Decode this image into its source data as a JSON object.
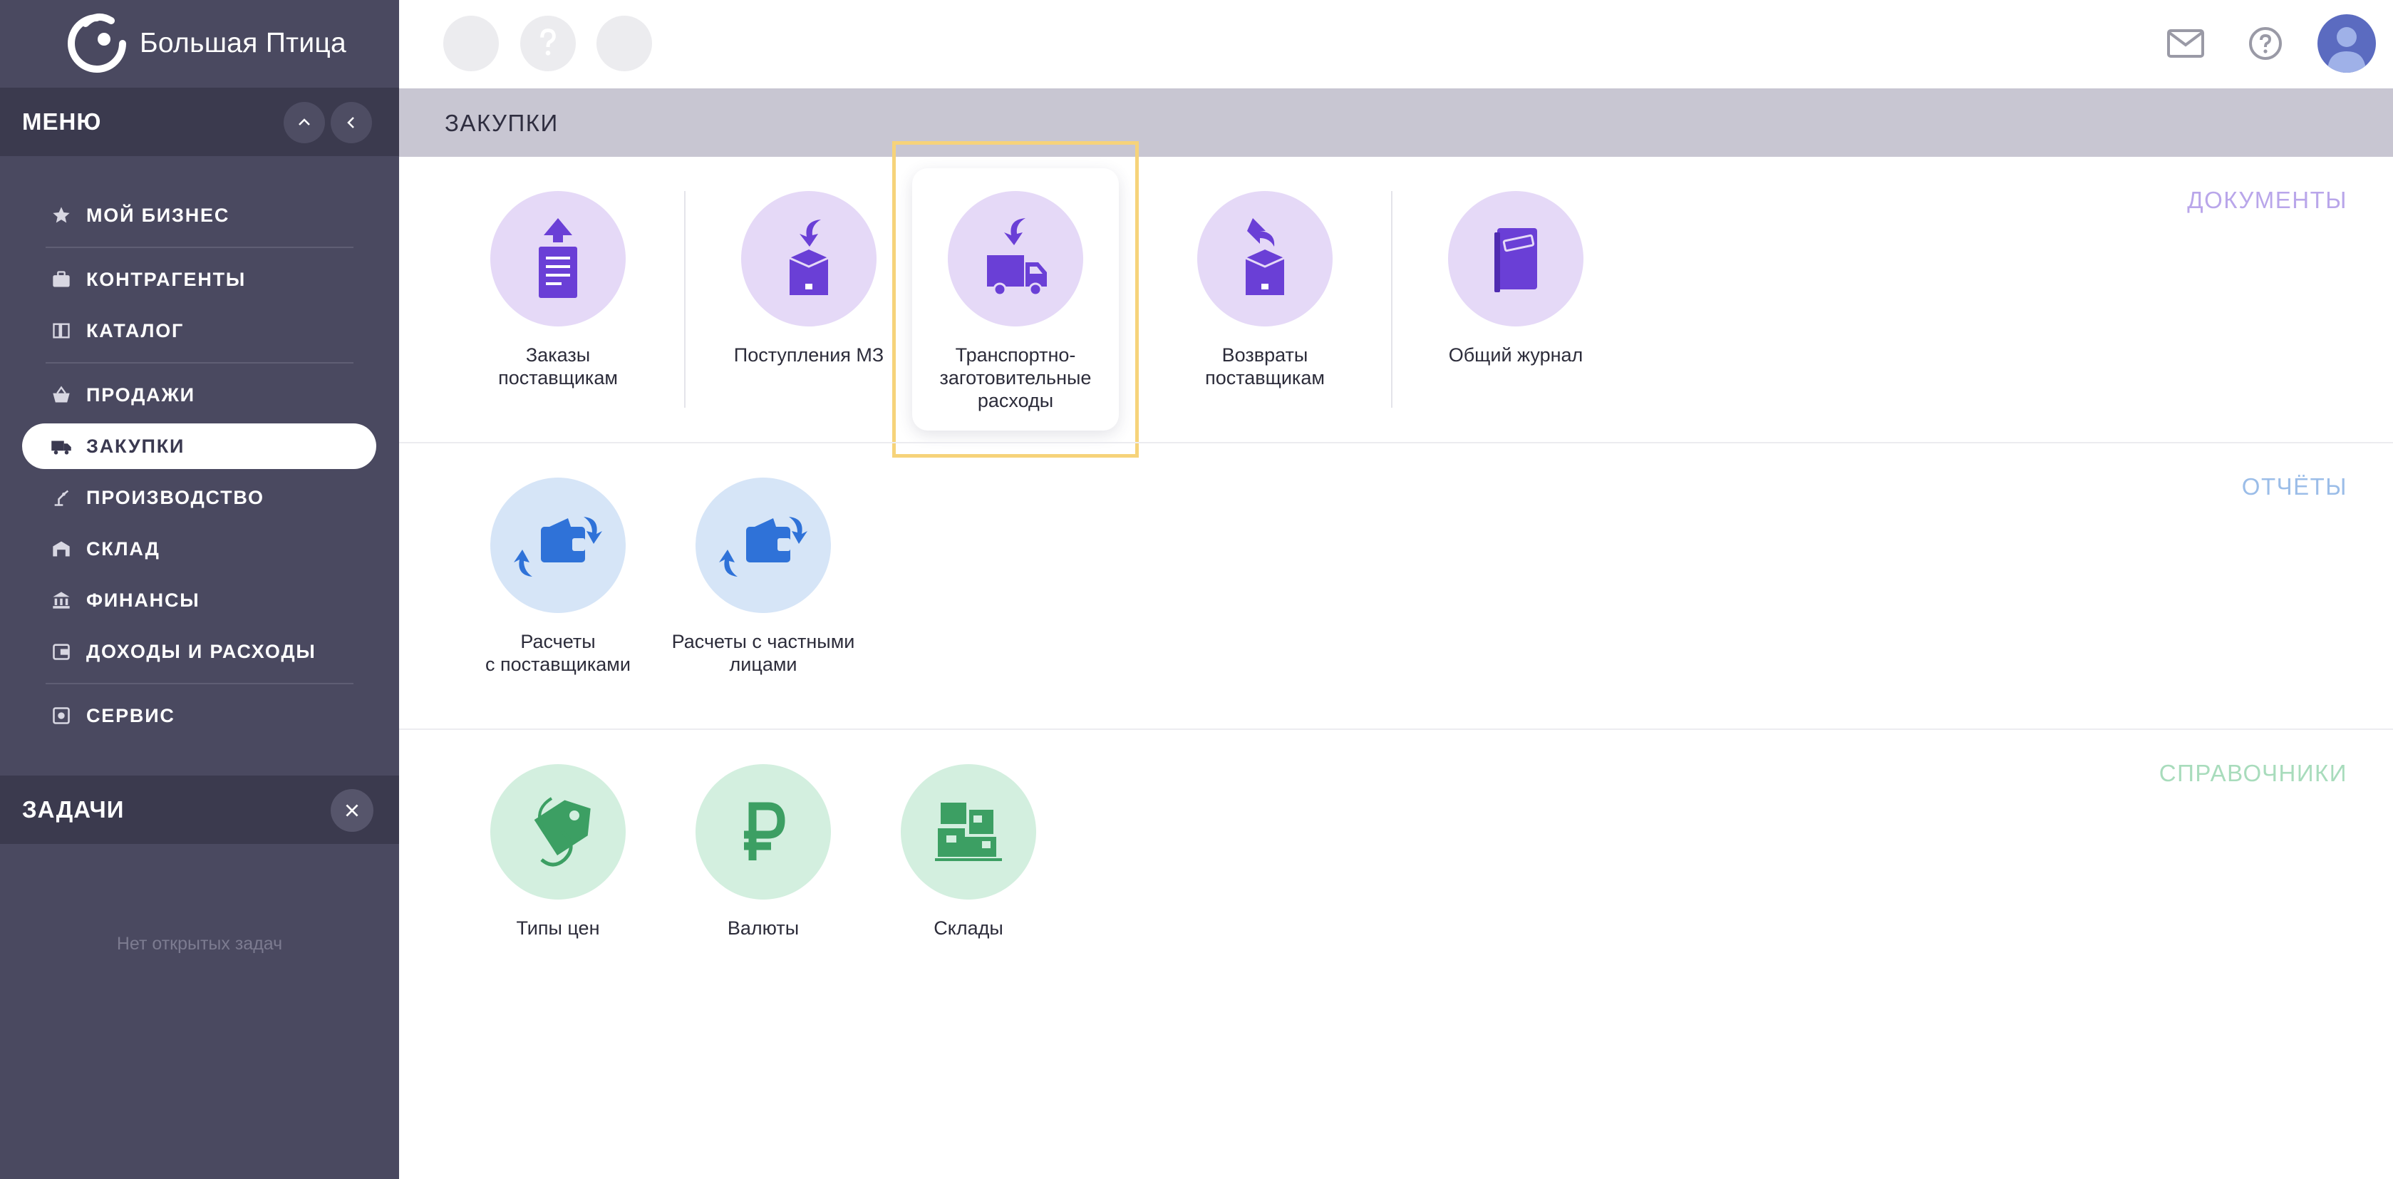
{
  "app": {
    "name": "Большая Птица"
  },
  "menu": {
    "title": "МЕНЮ",
    "items": [
      {
        "label": "МОЙ БИЗНЕС",
        "icon": "star-icon"
      },
      {
        "label": "КОНТРАГЕНТЫ",
        "icon": "briefcase-icon"
      },
      {
        "label": "КАТАЛОГ",
        "icon": "book-icon"
      },
      {
        "label": "ПРОДАЖИ",
        "icon": "basket-icon"
      },
      {
        "label": "ЗАКУПКИ",
        "icon": "truck-icon",
        "active": true
      },
      {
        "label": "ПРОИЗВОДСТВО",
        "icon": "robot-arm-icon"
      },
      {
        "label": "СКЛАД",
        "icon": "warehouse-icon"
      },
      {
        "label": "ФИНАНСЫ",
        "icon": "bank-icon"
      },
      {
        "label": "ДОХОДЫ И РАСХОДЫ",
        "icon": "wallet-icon"
      },
      {
        "label": "СЕРВИС",
        "icon": "service-icon"
      }
    ]
  },
  "tasks": {
    "title": "ЗАДАЧИ",
    "empty": "Нет открытых задач"
  },
  "section": {
    "title": "ЗАКУПКИ"
  },
  "groups": {
    "documents": {
      "label": "ДОКУМЕНТЫ",
      "color": "#b9a6ea",
      "tiles": [
        {
          "l1": "Заказы",
          "l2": "поставщикам",
          "l3": "",
          "icon": "order-doc-icon"
        },
        {
          "l1": "Поступления МЗ",
          "l2": "",
          "l3": "",
          "icon": "incoming-box-icon"
        },
        {
          "l1": "Транспортно-",
          "l2": "заготовительные",
          "l3": "расходы",
          "icon": "truck-incoming-icon",
          "highlighted": true
        },
        {
          "l1": "Возвраты",
          "l2": "поставщикам",
          "l3": "",
          "icon": "return-box-icon"
        },
        {
          "l1": "Общий журнал",
          "l2": "",
          "l3": "",
          "icon": "journal-icon"
        }
      ]
    },
    "reports": {
      "label": "ОТЧЁТЫ",
      "color": "#9bbde8",
      "tiles": [
        {
          "l1": "Расчеты",
          "l2": "с поставщиками",
          "icon": "wallet-exchange-icon"
        },
        {
          "l1": "Расчеты с частными",
          "l2": "лицами",
          "icon": "wallet-exchange-icon"
        }
      ]
    },
    "references": {
      "label": "СПРАВОЧНИКИ",
      "color": "#a8dcbc",
      "tiles": [
        {
          "l1": "Типы цен",
          "icon": "price-tag-icon"
        },
        {
          "l1": "Валюты",
          "icon": "ruble-icon"
        },
        {
          "l1": "Склады",
          "icon": "warehouse-boxes-icon"
        }
      ]
    }
  },
  "colors": {
    "sidebar": "#4a4960",
    "sidebar_header": "#3b3a4e",
    "purple": "#6a3fd6",
    "purple_bg": "#e5d9f7",
    "blue": "#2f72d8",
    "blue_bg": "#d6e5f7",
    "green": "#3c9f63",
    "green_bg": "#d3efdf",
    "highlight": "#f6d37a"
  }
}
